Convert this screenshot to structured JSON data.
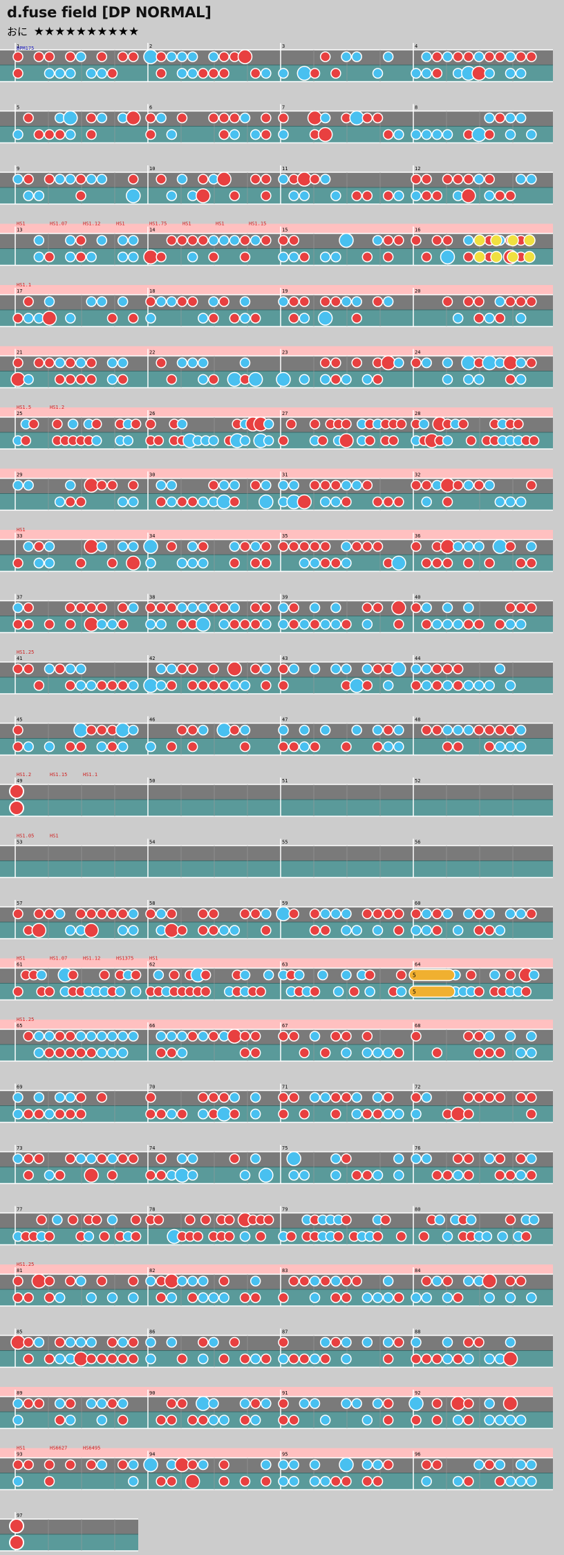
{
  "title": "d.fuse field [DP NORMAL]",
  "difficulty": {
    "label": "おに",
    "stars": "★★★★★★★★★★"
  },
  "bpm_label": "BPM175",
  "colors": {
    "don": "#e84040",
    "ka": "#48c0f0",
    "roll": "#f0e040",
    "balloon": "#f0b030",
    "hs_band": "#ffc0c0"
  },
  "balloon_labels": [
    "5",
    "5"
  ],
  "measure_count": 97,
  "hs_labels": [
    {
      "measure": 13,
      "texts": [
        "HS1",
        "HS1.07",
        "HS1.12",
        "HS1",
        "HS1.75",
        "HS1",
        "HS1",
        "HS1.15"
      ]
    },
    {
      "measure": 17,
      "texts": [
        "HS1.1"
      ]
    },
    {
      "measure": 25,
      "texts": [
        "HS1.5",
        "HS1.2"
      ]
    },
    {
      "measure": 33,
      "texts": [
        "HS1"
      ]
    },
    {
      "measure": 41,
      "texts": [
        "HS1.25"
      ]
    },
    {
      "measure": 49,
      "texts": [
        "HS1.2",
        "HS1.15",
        "HS1.1"
      ]
    },
    {
      "measure": 53,
      "texts": [
        "HS1.05",
        "HS1"
      ]
    },
    {
      "measure": 61,
      "texts": [
        "HS1",
        "HS1.07",
        "HS1.12",
        "HS1375",
        "HS1"
      ]
    },
    {
      "measure": 65,
      "texts": [
        "HS1.25"
      ]
    },
    {
      "measure": 81,
      "texts": [
        "HS1.25"
      ]
    },
    {
      "measure": 93,
      "texts": [
        "HS1",
        "HS6627",
        "HS6495"
      ]
    }
  ]
}
